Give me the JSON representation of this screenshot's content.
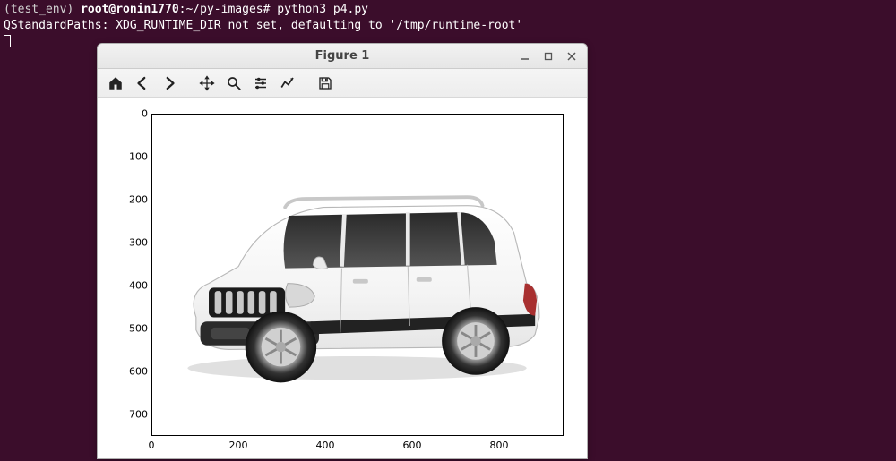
{
  "terminal": {
    "line1_env": "(test_env) ",
    "line1_userhost": "root@ronin1770",
    "line1_path": ":~/py-images# ",
    "line1_cmd": "python3 p4.py",
    "line2": "QStandardPaths: XDG_RUNTIME_DIR not set, defaulting to '/tmp/runtime-root'"
  },
  "window": {
    "title": "Figure 1"
  },
  "plot": {
    "y_ticks": [
      "0",
      "100",
      "200",
      "300",
      "400",
      "500",
      "600",
      "700"
    ],
    "x_ticks": [
      "0",
      "200",
      "400",
      "600",
      "800"
    ],
    "y_range": [
      0,
      750
    ],
    "x_range": [
      0,
      950
    ]
  }
}
